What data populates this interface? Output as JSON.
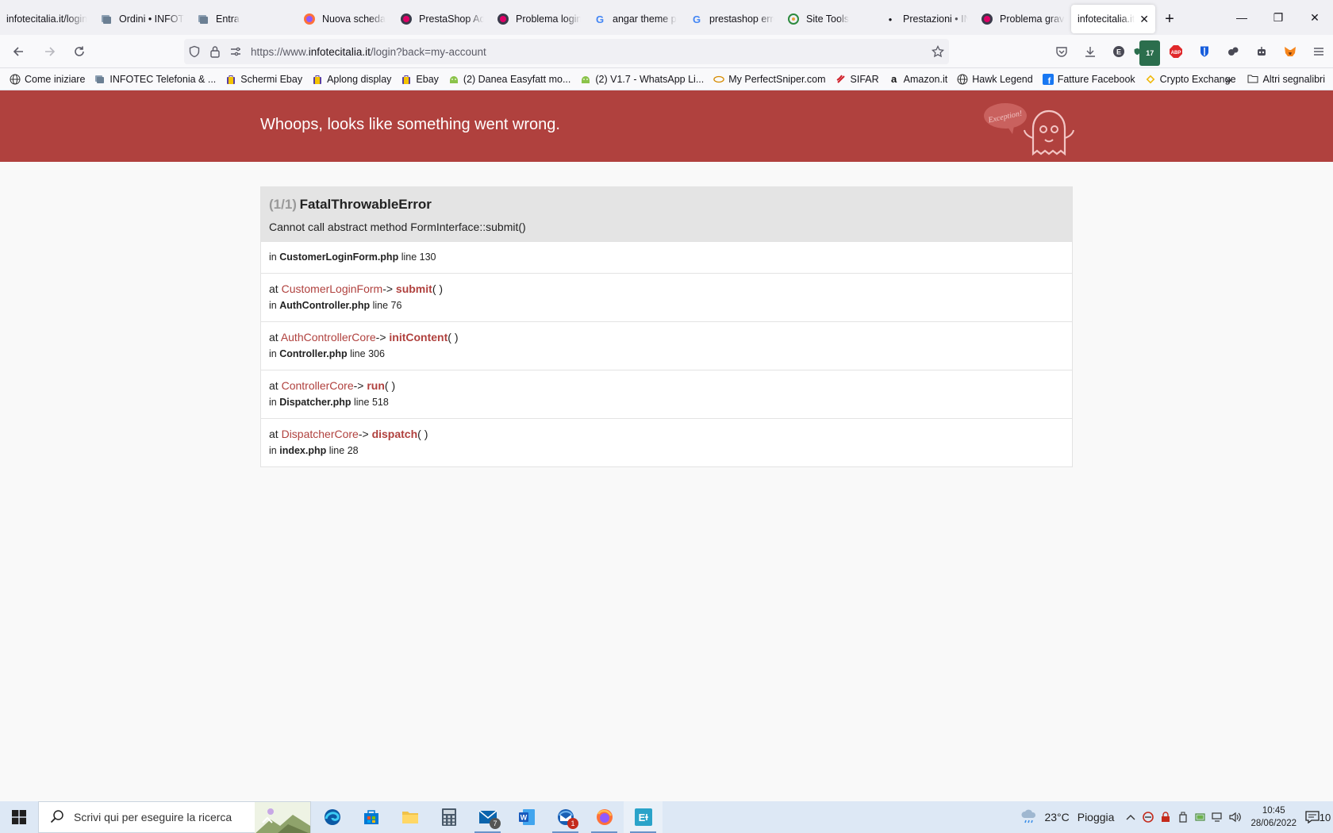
{
  "browser": {
    "tabs": [
      {
        "label": "infotecitalia.it/login",
        "icon": "none"
      },
      {
        "label": "Ordini • INFOTEC",
        "icon": "prestashop-icon"
      },
      {
        "label": "Entra",
        "icon": "prestashop-icon"
      },
      {
        "label": "",
        "icon": "none"
      },
      {
        "label": "Nuova scheda",
        "icon": "firefox-icon"
      },
      {
        "label": "PrestaShop Addons",
        "icon": "prestashop-icon"
      },
      {
        "label": "Problema login",
        "icon": "prestashop-icon"
      },
      {
        "label": "angar theme p",
        "icon": "google-icon"
      },
      {
        "label": "prestashop erro",
        "icon": "google-icon"
      },
      {
        "label": "Site Tools",
        "icon": "sitetools-icon"
      },
      {
        "label": "Prestazioni • INFOTEC",
        "icon": "dot-icon"
      },
      {
        "label": "Problema grave",
        "icon": "prestashop-icon"
      },
      {
        "label": "infotecitalia.it/login",
        "icon": "none",
        "active": true
      }
    ],
    "tab_close": "✕",
    "new_tab": "+",
    "url": {
      "prefix": "https://www.",
      "host": "infotecitalia.it",
      "path": "/login?back=my-account"
    },
    "ext_badge_count": "17",
    "bookmarks": [
      {
        "label": "Come iniziare",
        "icon": "globe-icon"
      },
      {
        "label": "INFOTEC Telefonia & ...",
        "icon": "prestashop-icon"
      },
      {
        "label": "Schermi Ebay",
        "icon": "bag-icon"
      },
      {
        "label": "Aplong display",
        "icon": "bag-icon"
      },
      {
        "label": "Ebay",
        "icon": "bag-icon"
      },
      {
        "label": "(2) Danea Easyfatt mo...",
        "icon": "android-icon"
      },
      {
        "label": "(2) V1.7 - WhatsApp Li...",
        "icon": "android-icon"
      },
      {
        "label": "My PerfectSniper.com",
        "icon": "sniper-icon"
      },
      {
        "label": "SIFAR",
        "icon": "sifar-icon"
      },
      {
        "label": "Amazon.it",
        "icon": "amazon-icon"
      },
      {
        "label": "Hawk Legend",
        "icon": "globe-icon"
      },
      {
        "label": "Fatture Facebook",
        "icon": "facebook-icon"
      },
      {
        "label": "Crypto Exchange",
        "icon": "binance-icon"
      }
    ],
    "bookmarks_other": "Altri segnalibri"
  },
  "error_page": {
    "header_title": "Whoops, looks like something went wrong.",
    "ghost_text": "Exception!",
    "count": "(1/1)",
    "exception_class": "FatalThrowableError",
    "message": "Cannot call abstract method FormInterface::submit()",
    "origin": {
      "in": "in",
      "file": "CustomerLoginForm.php",
      "line_label": "line",
      "line": "130"
    },
    "trace": [
      {
        "at": "at",
        "class": "CustomerLoginForm",
        "arrow": "->",
        "method": "submit",
        "parens": "( )",
        "in": "in",
        "file": "AuthController.php",
        "line_label": "line",
        "line": "76"
      },
      {
        "at": "at",
        "class": "AuthControllerCore",
        "arrow": "->",
        "method": "initContent",
        "parens": "( )",
        "in": "in",
        "file": "Controller.php",
        "line_label": "line",
        "line": "306"
      },
      {
        "at": "at",
        "class": "ControllerCore",
        "arrow": "->",
        "method": "run",
        "parens": "( )",
        "in": "in",
        "file": "Dispatcher.php",
        "line_label": "line",
        "line": "518"
      },
      {
        "at": "at",
        "class": "DispatcherCore",
        "arrow": "->",
        "method": "dispatch",
        "parens": "( )",
        "in": "in",
        "file": "index.php",
        "line_label": "line",
        "line": "28"
      }
    ]
  },
  "taskbar": {
    "search_placeholder": "Scrivi qui per eseguire la ricerca",
    "mail_badge": "7",
    "thunderbird_badge": "1",
    "weather": {
      "temp": "23°C",
      "condition": "Pioggia"
    },
    "time": "10:45",
    "date": "28/06/2022",
    "notification_count": "10"
  },
  "colors": {
    "header_red": "#b0413e",
    "tab_bar": "#f0f0f4",
    "taskbar": "#dde8f5"
  }
}
